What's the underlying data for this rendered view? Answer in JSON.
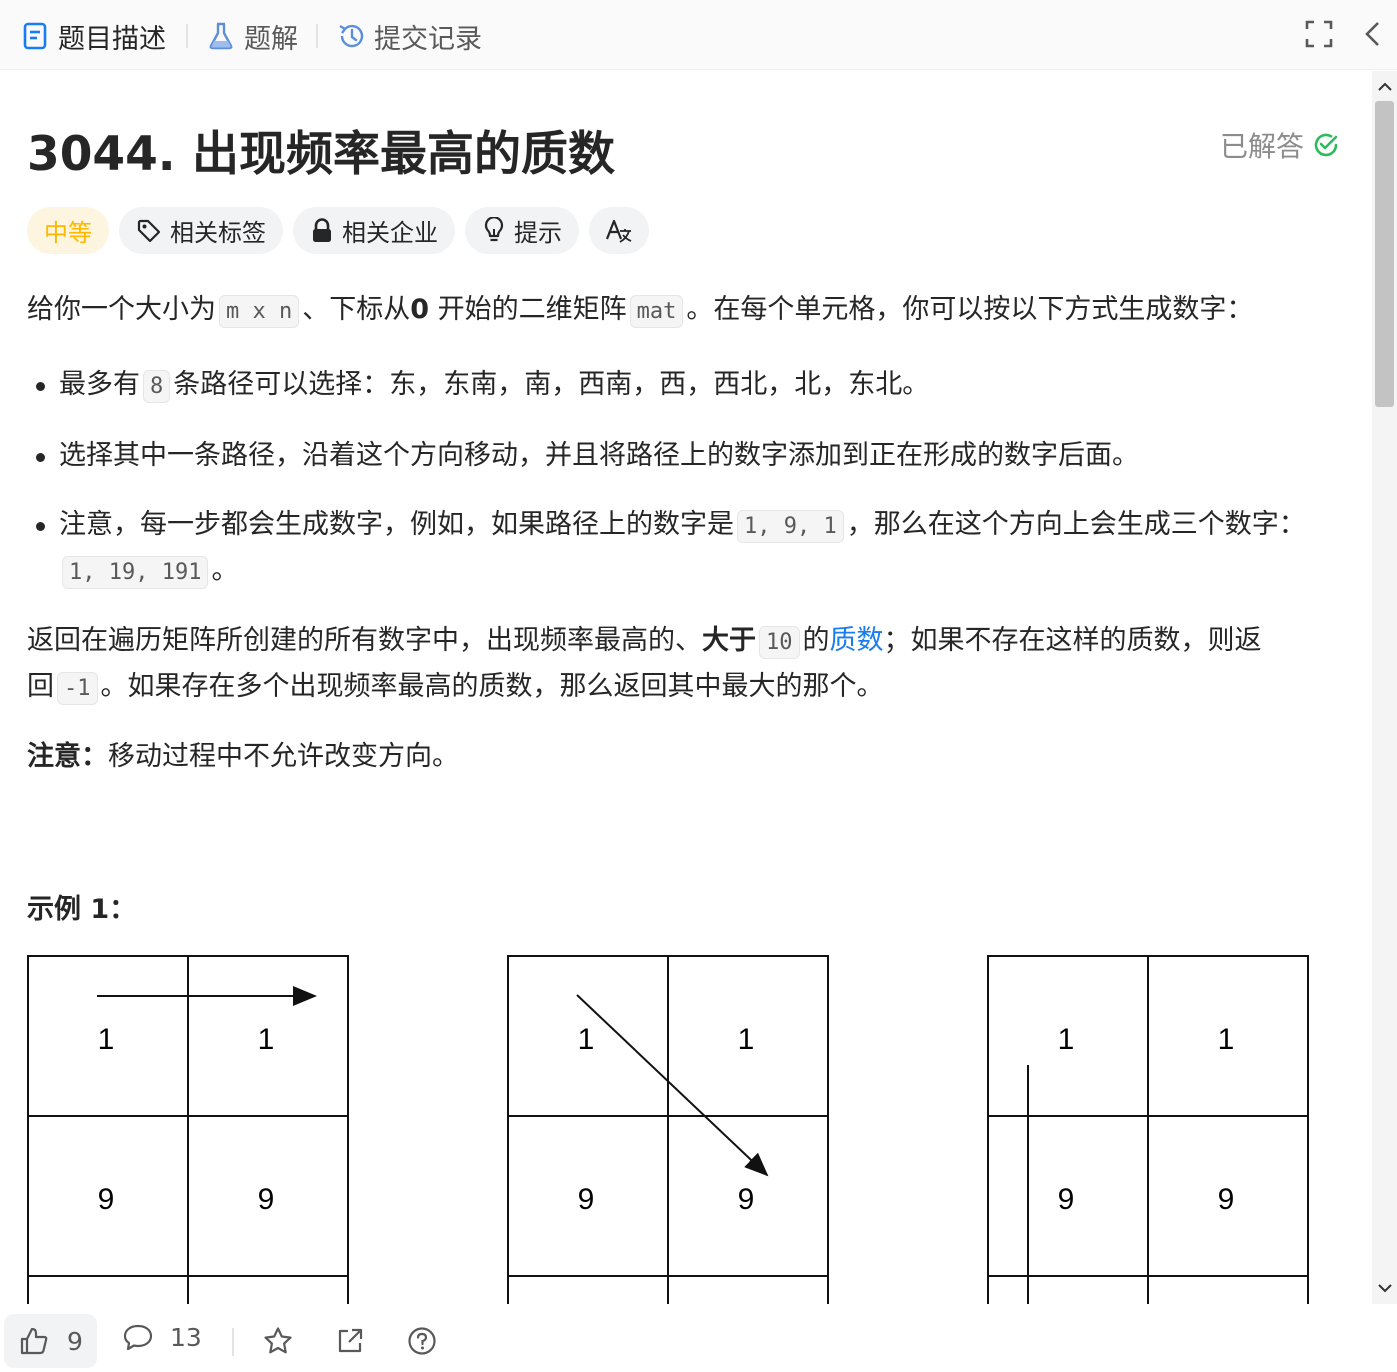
{
  "tabs": [
    {
      "label": "题目描述",
      "icon": "document-icon",
      "active": true
    },
    {
      "label": "题解",
      "icon": "flask-icon",
      "active": false
    },
    {
      "label": "提交记录",
      "icon": "history-icon",
      "active": false
    }
  ],
  "problem": {
    "title": "3044. 出现频率最高的质数",
    "status": "已解答",
    "chips": {
      "difficulty": "中等",
      "tags": "相关标签",
      "companies": "相关企业",
      "hint": "提示"
    }
  },
  "description": {
    "p1": {
      "t1": "给你一个大小为",
      "code1": "m x n",
      "t2": "、下标从",
      "bold": "0",
      "t3": "开始的二维矩阵",
      "code2": "mat",
      "t4": "。在每个单元格，你可以按以下方式生成数字："
    },
    "bullets": {
      "b1_t1": "最多有",
      "b1_code": "8",
      "b1_t2": "条路径可以选择：东，东南，南，西南，西，西北，北，东北。",
      "b2": "选择其中一条路径，沿着这个方向移动，并且将路径上的数字添加到正在形成的数字后面。",
      "b3_t1": "注意，每一步都会生成数字，例如，如果路径上的数字是",
      "b3_code1": "1, 9, 1",
      "b3_t2": "，那么在这个方向上会生成三个数字：",
      "b3_code2": "1, 19, 191",
      "b3_t3": "。"
    },
    "p2": {
      "t1": "返回在遍历矩阵所创建的所有数字中，出现频率最高的、",
      "bold": "大于",
      "code1": "10",
      "t2": "的",
      "link": "质数",
      "t3": "；如果不存在这样的质数，则返回",
      "code2": "-1",
      "t4": "。如果存在多个出现频率最高的质数，那么返回其中最大的那个。"
    },
    "note": {
      "bold": "注意：",
      "text": "移动过程中不允许改变方向。"
    },
    "example_title": "示例 1："
  },
  "example_grids": [
    {
      "cells": [
        "1",
        "1",
        "9",
        "9"
      ],
      "arrow": "east"
    },
    {
      "cells": [
        "1",
        "1",
        "9",
        "9"
      ],
      "arrow": "southeast"
    },
    {
      "cells": [
        "1",
        "1",
        "9",
        "9"
      ],
      "arrow": "south"
    }
  ],
  "bottom_bar": {
    "likes": "9",
    "comments": "13"
  }
}
